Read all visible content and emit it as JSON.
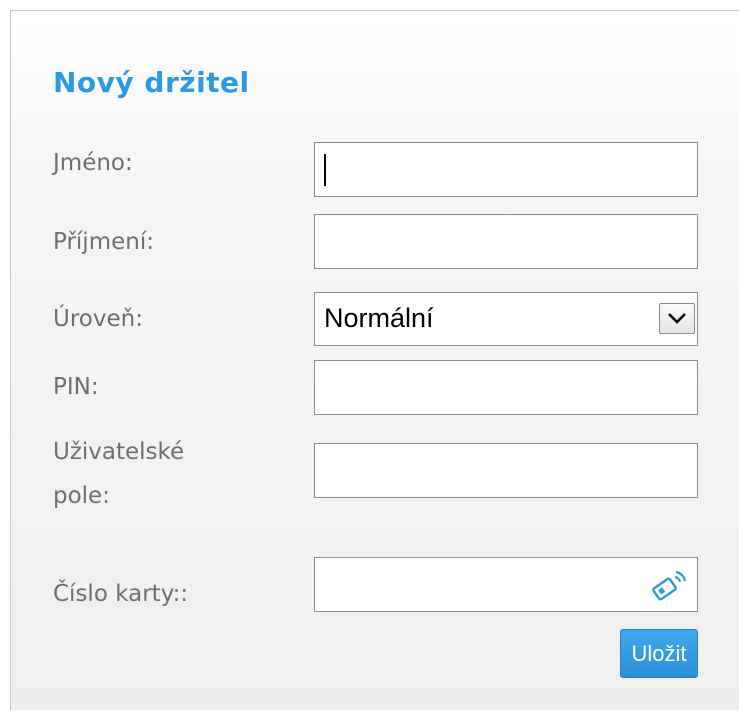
{
  "form": {
    "title": "Nový držitel",
    "fields": {
      "first_name": {
        "label": "Jméno:",
        "value": ""
      },
      "last_name": {
        "label": "Příjmení:",
        "value": ""
      },
      "level": {
        "label": "Úroveň:",
        "value": "Normální"
      },
      "pin": {
        "label": "PIN:",
        "value": ""
      },
      "user_field": {
        "label_line1": "Uživatelské",
        "label_line2": "pole:",
        "value": ""
      },
      "card_number": {
        "label": "Číslo karty::",
        "value": ""
      }
    },
    "save_label": "Uložit"
  },
  "colors": {
    "title": "#2a9ae3",
    "button": "#3399e0",
    "label": "#6f6f6f"
  },
  "icons": {
    "select_arrow": "chevron-down-icon",
    "card_reader": "rfid-card-icon"
  }
}
